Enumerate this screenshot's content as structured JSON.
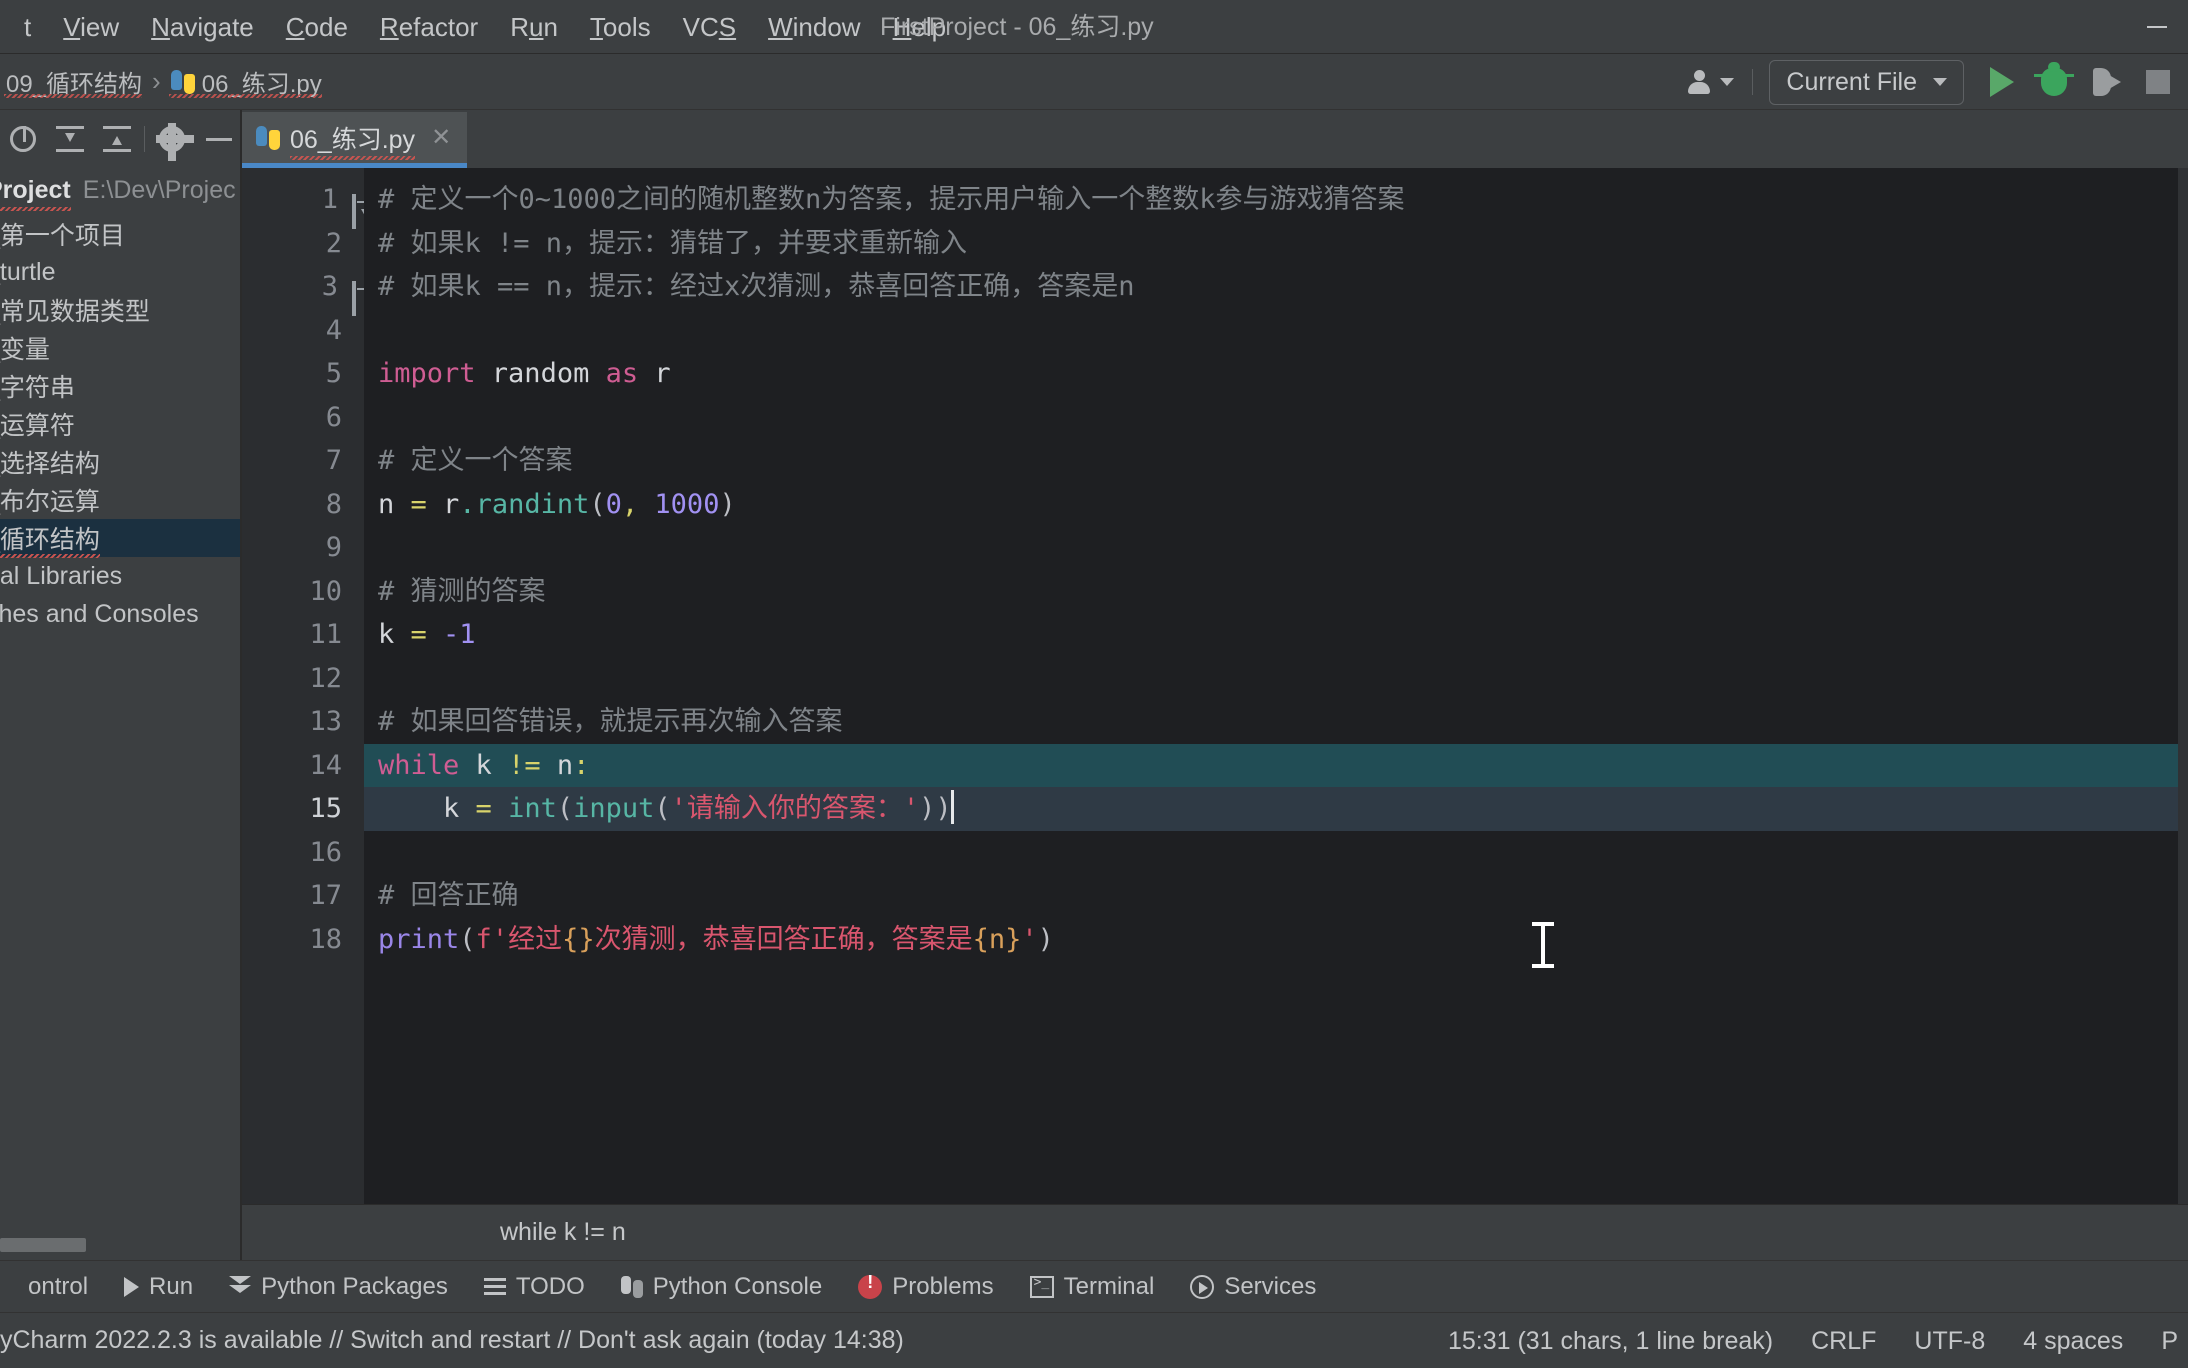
{
  "window": {
    "title": "FirstProject - 06_练习.py",
    "minimize_label": "—"
  },
  "menubar": {
    "items": [
      {
        "pre": "",
        "mn": "",
        "post": "t"
      },
      {
        "pre": "",
        "mn": "V",
        "post": "iew"
      },
      {
        "pre": "",
        "mn": "N",
        "post": "avigate"
      },
      {
        "pre": "",
        "mn": "C",
        "post": "ode"
      },
      {
        "pre": "",
        "mn": "R",
        "post": "efactor"
      },
      {
        "pre": "R",
        "mn": "u",
        "post": "n"
      },
      {
        "pre": "",
        "mn": "T",
        "post": "ools"
      },
      {
        "pre": "VC",
        "mn": "S",
        "post": ""
      },
      {
        "pre": "",
        "mn": "W",
        "post": "indow"
      },
      {
        "pre": "",
        "mn": "H",
        "post": "elp"
      }
    ]
  },
  "navbar": {
    "breadcrumbs": [
      "09_循环结构",
      "06_练习.py"
    ],
    "separator": "›",
    "run_config": "Current File",
    "run_config_caret": "▼"
  },
  "sidebar": {
    "project_label": "Project",
    "project_path": "E:\\Dev\\Projec",
    "items": [
      {
        "label": "_第一个项目",
        "selected": false
      },
      {
        "label": "_turtle",
        "selected": false
      },
      {
        "label": "_常见数据类型",
        "selected": false
      },
      {
        "label": "_变量",
        "selected": false
      },
      {
        "label": "_字符串",
        "selected": false
      },
      {
        "label": "_运算符",
        "selected": false
      },
      {
        "label": "_选择结构",
        "selected": false
      },
      {
        "label": "_布尔运算",
        "selected": false
      },
      {
        "label": "_循环结构",
        "selected": true
      },
      {
        "label": "nal Libraries",
        "selected": false
      },
      {
        "label": "ches and Consoles",
        "selected": false
      }
    ]
  },
  "editor": {
    "tab": {
      "label": "06_练习.py",
      "close": "✕"
    },
    "lines": [
      {
        "num": "1",
        "fold": "open",
        "tokens": [
          {
            "t": "# 定义一个0~1000之间的随机整数n为答案，提示用户输入一个整数k参与游戏猜答案",
            "c": "tok-cm"
          }
        ]
      },
      {
        "num": "2",
        "fold": "",
        "tokens": [
          {
            "t": "# 如果k != n，提示：猜错了，并要求重新输入",
            "c": "tok-cm"
          }
        ]
      },
      {
        "num": "3",
        "fold": "end",
        "tokens": [
          {
            "t": "# 如果k == n，提示：经过x次猜测，恭喜回答正确，答案是n",
            "c": "tok-cm"
          }
        ]
      },
      {
        "num": "4",
        "fold": "",
        "tokens": []
      },
      {
        "num": "5",
        "fold": "",
        "tokens": [
          {
            "t": "import ",
            "c": "tok-kw"
          },
          {
            "t": "random ",
            "c": "tok-id"
          },
          {
            "t": "as ",
            "c": "tok-kw"
          },
          {
            "t": "r",
            "c": "tok-id"
          }
        ]
      },
      {
        "num": "6",
        "fold": "",
        "tokens": []
      },
      {
        "num": "7",
        "fold": "",
        "tokens": [
          {
            "t": "# 定义一个答案",
            "c": "tok-cm"
          }
        ]
      },
      {
        "num": "8",
        "fold": "",
        "tokens": [
          {
            "t": "n ",
            "c": "tok-id"
          },
          {
            "t": "= ",
            "c": "tok-op"
          },
          {
            "t": "r",
            "c": "tok-id"
          },
          {
            "t": ".",
            "c": "tok-fn"
          },
          {
            "t": "randint",
            "c": "tok-fn"
          },
          {
            "t": "(",
            "c": "tok-punct"
          },
          {
            "t": "0",
            "c": "tok-num"
          },
          {
            "t": ",",
            "c": "tok-op"
          },
          {
            "t": " ",
            "c": "tok-punct"
          },
          {
            "t": "1000",
            "c": "tok-num"
          },
          {
            "t": ")",
            "c": "tok-punct"
          }
        ]
      },
      {
        "num": "9",
        "fold": "",
        "tokens": []
      },
      {
        "num": "10",
        "fold": "",
        "tokens": [
          {
            "t": "# 猜测的答案",
            "c": "tok-cm"
          }
        ]
      },
      {
        "num": "11",
        "fold": "",
        "tokens": [
          {
            "t": "k ",
            "c": "tok-id"
          },
          {
            "t": "= ",
            "c": "tok-op"
          },
          {
            "t": "-1",
            "c": "tok-num"
          }
        ]
      },
      {
        "num": "12",
        "fold": "",
        "tokens": []
      },
      {
        "num": "13",
        "fold": "",
        "tokens": [
          {
            "t": "# 如果回答错误，就提示再次输入答案",
            "c": "tok-cm"
          }
        ]
      },
      {
        "num": "14",
        "fold": "",
        "highlight": "sel",
        "tokens": [
          {
            "t": "while ",
            "c": "tok-kw"
          },
          {
            "t": "k ",
            "c": "tok-id"
          },
          {
            "t": "!=",
            "c": "tok-op"
          },
          {
            "t": " n",
            "c": "tok-id"
          },
          {
            "t": ":",
            "c": "tok-op"
          }
        ]
      },
      {
        "num": "15",
        "fold": "",
        "highlight": "cur",
        "caret": true,
        "tokens": [
          {
            "t": "    k ",
            "c": "tok-id"
          },
          {
            "t": "= ",
            "c": "tok-op"
          },
          {
            "t": "int",
            "c": "tok-fn"
          },
          {
            "t": "(",
            "c": "tok-punct"
          },
          {
            "t": "input",
            "c": "tok-fn"
          },
          {
            "t": "(",
            "c": "tok-punct"
          },
          {
            "t": "'请输入你的答案：'",
            "c": "tok-str"
          },
          {
            "t": "))",
            "c": "tok-punct"
          }
        ]
      },
      {
        "num": "16",
        "fold": "",
        "tokens": []
      },
      {
        "num": "17",
        "fold": "",
        "tokens": [
          {
            "t": "# 回答正确",
            "c": "tok-cm"
          }
        ]
      },
      {
        "num": "18",
        "fold": "",
        "tokens": [
          {
            "t": "print",
            "c": "tok-print"
          },
          {
            "t": "(",
            "c": "tok-punct"
          },
          {
            "t": "f",
            "c": "tok-fpfx"
          },
          {
            "t": "'经过",
            "c": "tok-str"
          },
          {
            "t": "{}",
            "c": "tok-brace"
          },
          {
            "t": "次猜测，恭喜回答正确，答案是",
            "c": "tok-str"
          },
          {
            "t": "{n}",
            "c": "tok-brace"
          },
          {
            "t": "'",
            "c": "tok-str"
          },
          {
            "t": ")",
            "c": "tok-punct"
          }
        ]
      }
    ]
  },
  "code_breadcrumb": "while k != n",
  "toolwindows": [
    {
      "label": "ontrol",
      "icon": "version-control-icon"
    },
    {
      "label": "Run",
      "icon": "run-icon"
    },
    {
      "label": "Python Packages",
      "icon": "python-packages-icon"
    },
    {
      "label": "TODO",
      "icon": "todo-icon"
    },
    {
      "label": "Python Console",
      "icon": "python-console-icon"
    },
    {
      "label": "Problems",
      "icon": "problems-icon"
    },
    {
      "label": "Terminal",
      "icon": "terminal-icon"
    },
    {
      "label": "Services",
      "icon": "services-icon"
    }
  ],
  "statusbar": {
    "notification": "yCharm 2022.2.3 is available // Switch and restart // Don't ask again (today 14:38)",
    "caret_position": "15:31 (31 chars, 1 line break)",
    "line_separator": "CRLF",
    "encoding": "UTF-8",
    "indent": "4 spaces",
    "branch": "P"
  },
  "colors": {
    "accent_blue": "#4a88c7",
    "run_green": "#59a869",
    "error_red": "#c9434a",
    "selection_teal": "#214d55",
    "editor_bg": "#1e1f22",
    "panel_bg": "#3c3f41"
  }
}
